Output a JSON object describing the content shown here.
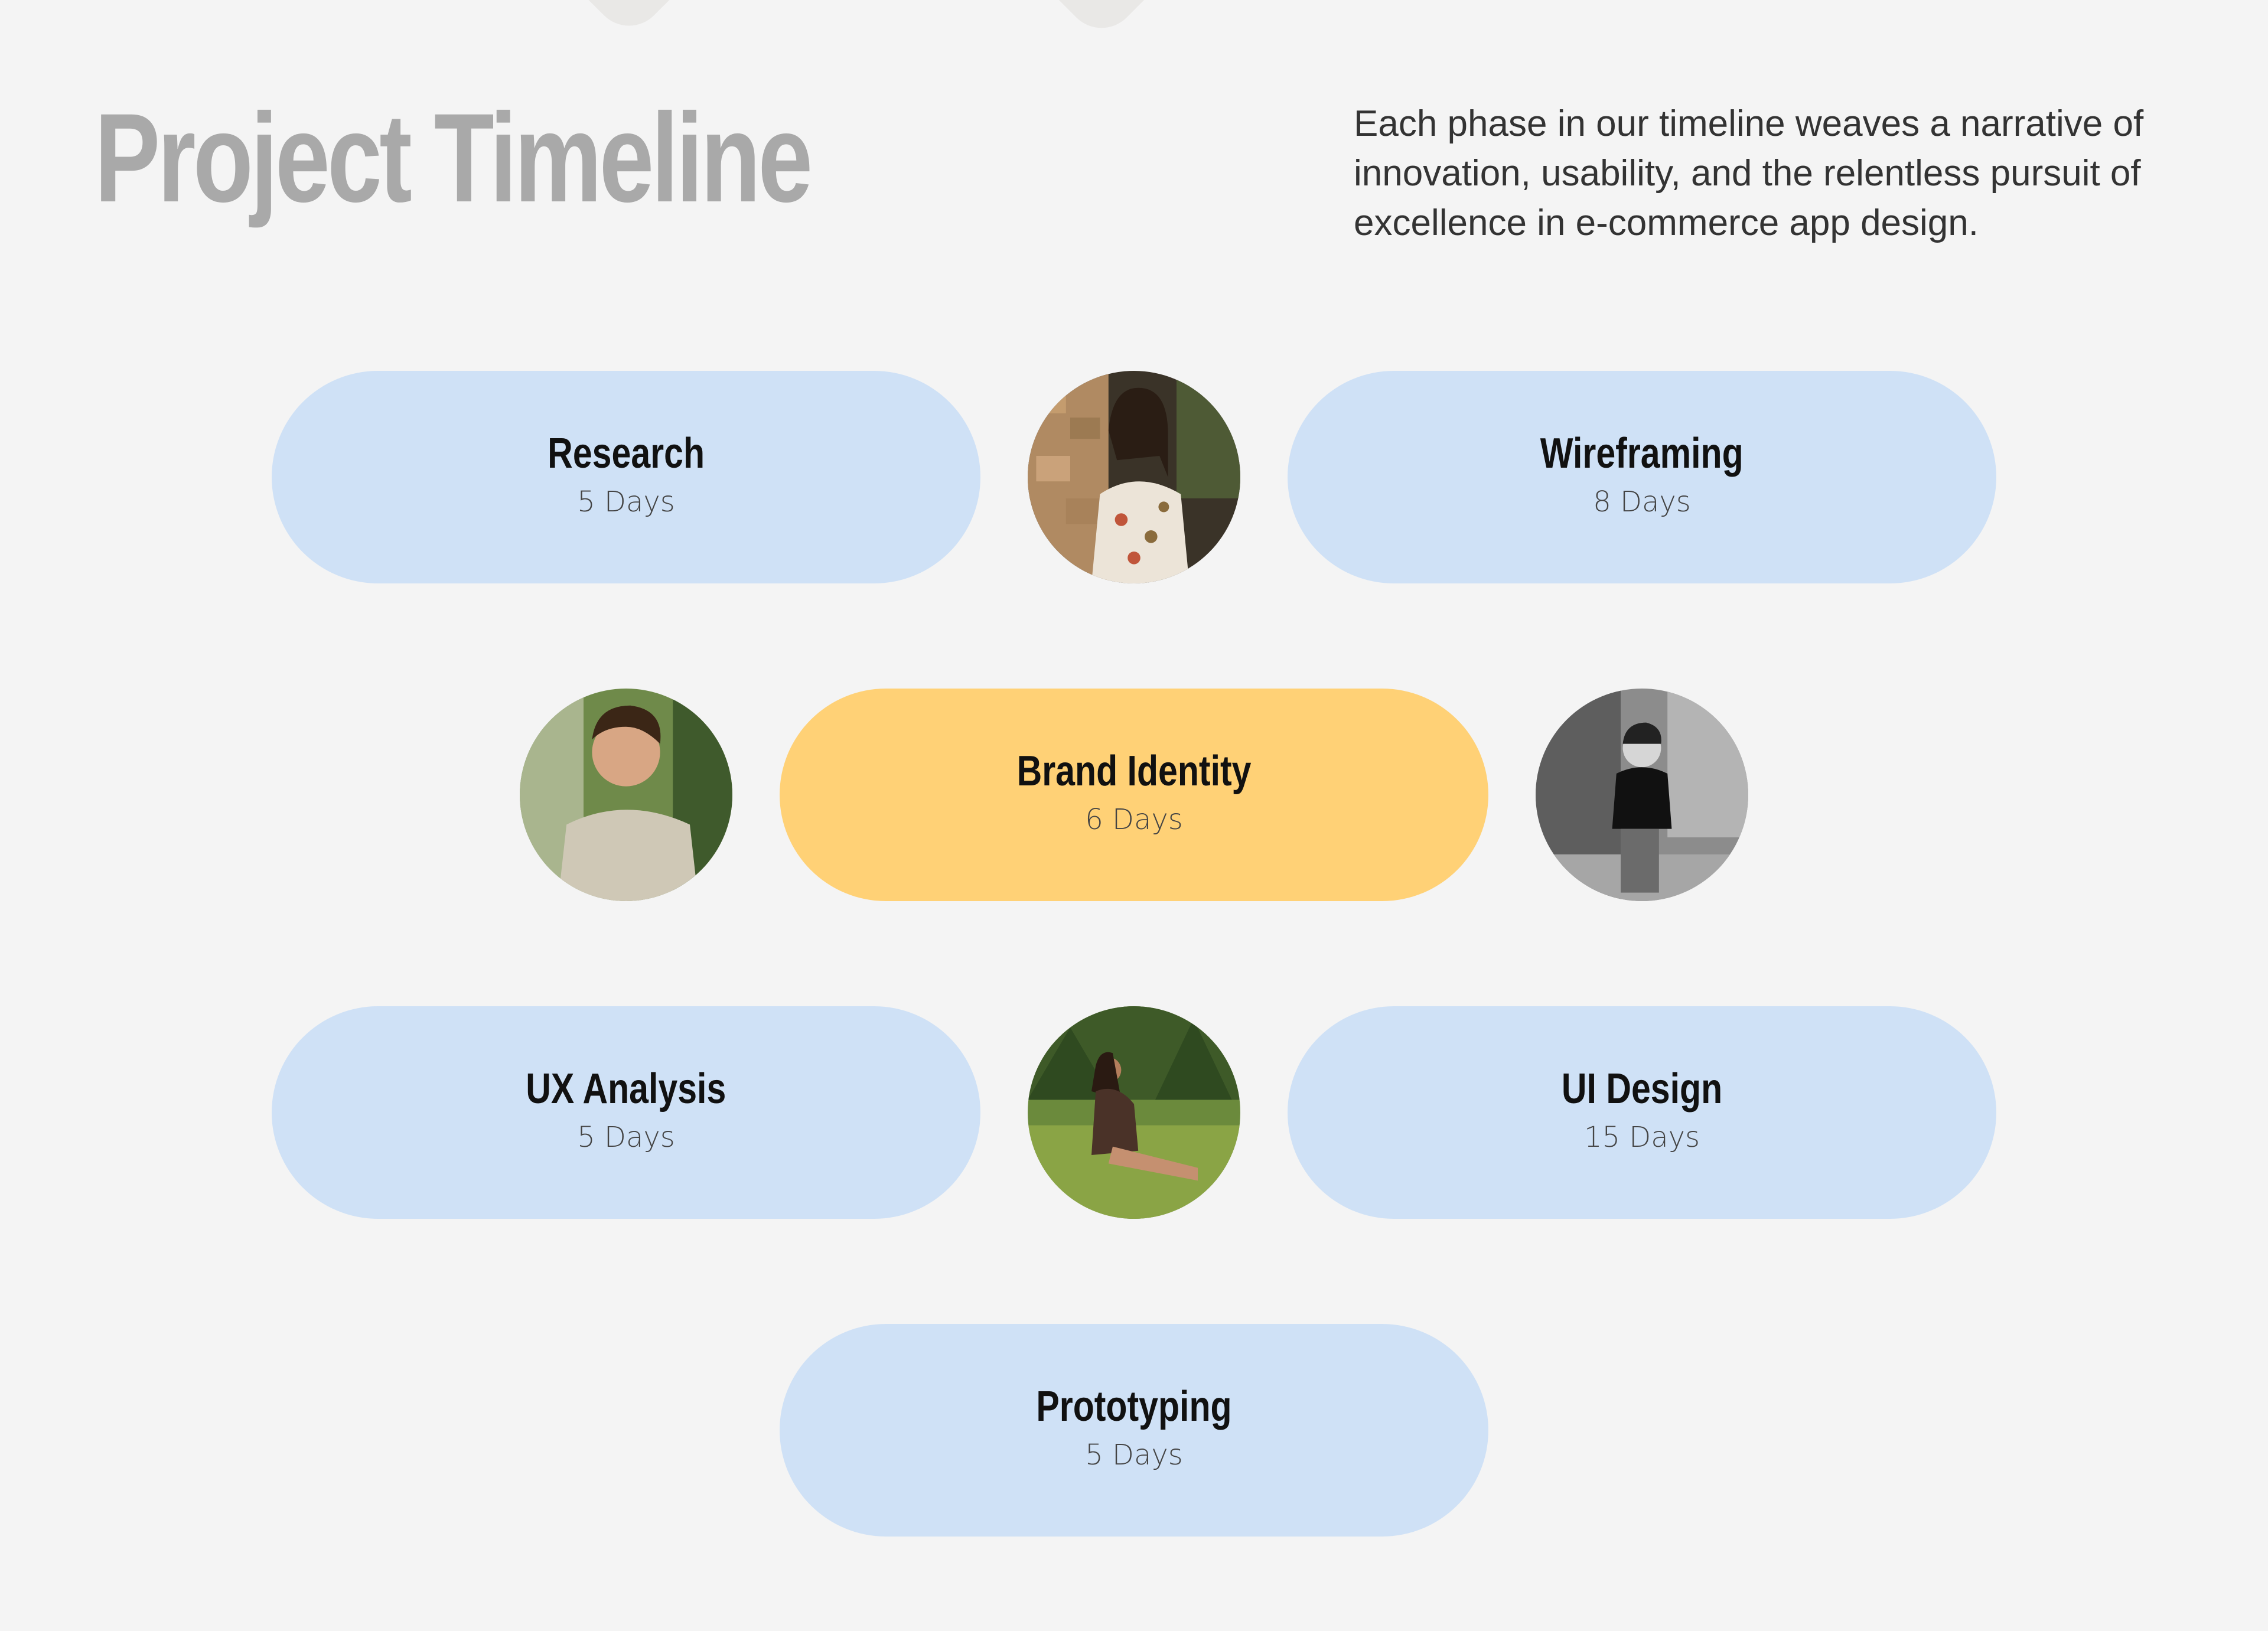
{
  "header": {
    "title": "Project Timeline",
    "description": "Each phase in our timeline weaves a narrative of innovation, usability, and the relentless pursuit of excellence in e-commerce app design."
  },
  "phases": [
    {
      "name": "Research",
      "duration": "5 Days"
    },
    {
      "name": "Wireframing",
      "duration": "8 Days"
    },
    {
      "name": "Brand Identity",
      "duration": "6 Days"
    },
    {
      "name": "UX Analysis",
      "duration": "5 Days"
    },
    {
      "name": "UI Design",
      "duration": "15 Days"
    },
    {
      "name": "Prototyping",
      "duration": "5 Days"
    }
  ],
  "colors": {
    "background": "#f4f4f4",
    "pill": "#cfe1f6",
    "pill_highlight": "#ffd176",
    "title": "#a9a9a9"
  }
}
